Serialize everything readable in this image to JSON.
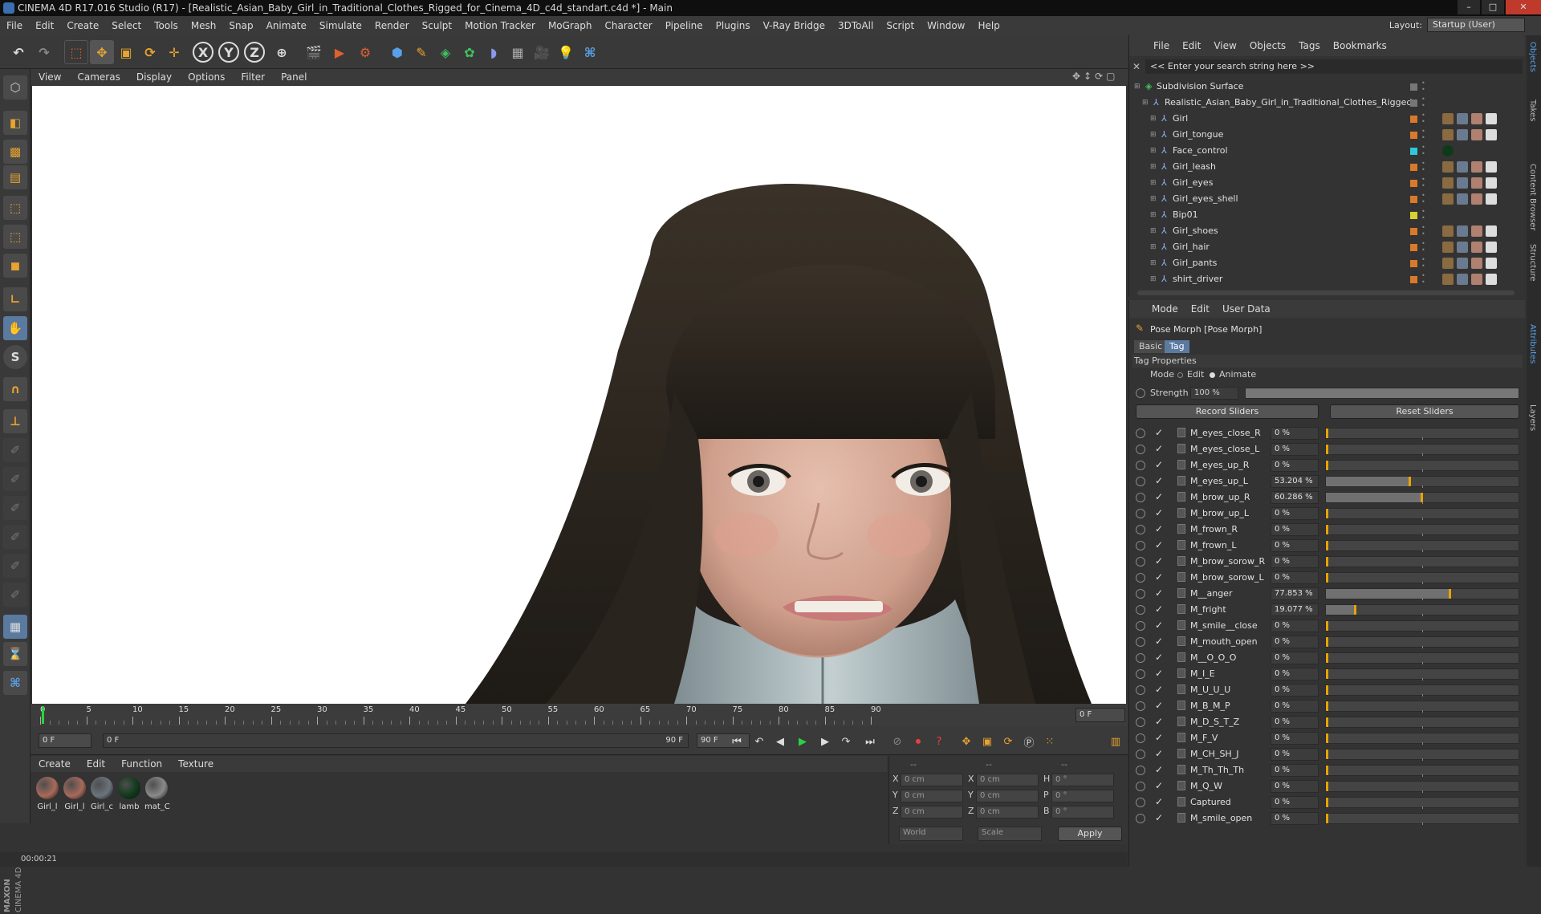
{
  "window": {
    "title": "CINEMA 4D R17.016 Studio (R17) - [Realistic_Asian_Baby_Girl_in_Traditional_Clothes_Rigged_for_Cinema_4D_c4d_standart.c4d *] - Main"
  },
  "menubar": [
    "File",
    "Edit",
    "Create",
    "Select",
    "Tools",
    "Mesh",
    "Snap",
    "Animate",
    "Simulate",
    "Render",
    "Sculpt",
    "Motion Tracker",
    "MoGraph",
    "Character",
    "Pipeline",
    "Plugins",
    "V-Ray Bridge",
    "3DToAll",
    "Script",
    "Window",
    "Help"
  ],
  "layout": {
    "label": "Layout:",
    "value": "Startup (User)"
  },
  "toolbar": {
    "x_axis": "X",
    "y_axis": "Y",
    "z_axis": "Z"
  },
  "viewport_menu": [
    "View",
    "Cameras",
    "Display",
    "Options",
    "Filter",
    "Panel"
  ],
  "timeline": {
    "ticks": [
      "0",
      "5",
      "10",
      "15",
      "20",
      "25",
      "30",
      "35",
      "40",
      "45",
      "50",
      "55",
      "60",
      "65",
      "70",
      "75",
      "80",
      "85",
      "90"
    ],
    "current_frame": "0 F",
    "start_field": "0 F",
    "range_start": "0 F",
    "range_end": "90 F",
    "end_field": "90 F"
  },
  "material_manager": {
    "menu": [
      "Create",
      "Edit",
      "Function",
      "Texture"
    ],
    "materials": [
      {
        "name": "Girl_l",
        "color": "#a86a5a"
      },
      {
        "name": "Girl_l",
        "color": "#a86a5a"
      },
      {
        "name": "Girl_c",
        "color": "#6b747e"
      },
      {
        "name": "lamb",
        "color": "#0f3a1a"
      },
      {
        "name": "mat_C",
        "color": "#8a8a8a"
      }
    ]
  },
  "coordinates": {
    "headers": [
      "--",
      "--",
      "--"
    ],
    "rows": [
      {
        "a": "X",
        "av": "0 cm",
        "b": "X",
        "bv": "0 cm",
        "c": "H",
        "cv": "0 °"
      },
      {
        "a": "Y",
        "av": "0 cm",
        "b": "Y",
        "bv": "0 cm",
        "c": "P",
        "cv": "0 °"
      },
      {
        "a": "Z",
        "av": "0 cm",
        "b": "Z",
        "bv": "0 cm",
        "c": "B",
        "cv": "0 °"
      }
    ],
    "world": "World",
    "scale": "Scale",
    "apply": "Apply"
  },
  "status": {
    "time": "00:00:21"
  },
  "object_manager": {
    "menu": [
      "File",
      "Edit",
      "View",
      "Objects",
      "Tags",
      "Bookmarks"
    ],
    "search_placeholder": "<< Enter your search string here >>",
    "objects": [
      {
        "name": "Subdivision Surface",
        "indent": 0,
        "color": "#777777"
      },
      {
        "name": "Realistic_Asian_Baby_Girl_in_Traditional_Clothes_Rigged",
        "indent": 1,
        "color": "#777777"
      },
      {
        "name": "Girl",
        "indent": 2,
        "color": "#d87a2a"
      },
      {
        "name": "Girl_tongue",
        "indent": 2,
        "color": "#d87a2a"
      },
      {
        "name": "Face_control",
        "indent": 2,
        "color": "#30c8d8"
      },
      {
        "name": "Girl_leash",
        "indent": 2,
        "color": "#d87a2a"
      },
      {
        "name": "Girl_eyes",
        "indent": 2,
        "color": "#d87a2a"
      },
      {
        "name": "Girl_eyes_shell",
        "indent": 2,
        "color": "#d87a2a"
      },
      {
        "name": "Bip01",
        "indent": 2,
        "color": "#d8d030"
      },
      {
        "name": "Girl_shoes",
        "indent": 2,
        "color": "#d87a2a"
      },
      {
        "name": "Girl_hair",
        "indent": 2,
        "color": "#d87a2a"
      },
      {
        "name": "Girl_pants",
        "indent": 2,
        "color": "#d87a2a"
      },
      {
        "name": "shirt_driver",
        "indent": 2,
        "color": "#d87a2a"
      }
    ]
  },
  "attributes": {
    "menu": [
      "Mode",
      "Edit",
      "User Data"
    ],
    "title": "Pose Morph [Pose Morph]",
    "tabs": [
      "Basic",
      "Tag"
    ],
    "section": "Tag Properties",
    "mode_label": "Mode",
    "mode_edit": "Edit",
    "mode_animate": "Animate",
    "strength_label": "Strength",
    "strength_value": "100 %",
    "strength": 1.0,
    "record_sliders": "Record Sliders",
    "reset_sliders": "Reset Sliders",
    "sliders": [
      {
        "name": "M_eyes_close_R",
        "value": "0 %",
        "fraction": 0
      },
      {
        "name": "M_eyes_close_L",
        "value": "0 %",
        "fraction": 0
      },
      {
        "name": "M_eyes_up_R",
        "value": "0 %",
        "fraction": 0
      },
      {
        "name": "M_eyes_up_L",
        "value": "53.204 %",
        "fraction": 0.53204
      },
      {
        "name": "M_brow_up_R",
        "value": "60.286 %",
        "fraction": 0.60286
      },
      {
        "name": "M_brow_up_L",
        "value": "0 %",
        "fraction": 0
      },
      {
        "name": "M_frown_R",
        "value": "0 %",
        "fraction": 0
      },
      {
        "name": "M_frown_L",
        "value": "0 %",
        "fraction": 0
      },
      {
        "name": "M_brow_sorow_R",
        "value": "0 %",
        "fraction": 0
      },
      {
        "name": "M_brow_sorow_L",
        "value": "0 %",
        "fraction": 0
      },
      {
        "name": "M__anger",
        "value": "77.853 %",
        "fraction": 0.77853
      },
      {
        "name": "M_fright",
        "value": "19.077 %",
        "fraction": 0.19077
      },
      {
        "name": "M_smile__close",
        "value": "0 %",
        "fraction": 0
      },
      {
        "name": "M_mouth_open",
        "value": "0 %",
        "fraction": 0
      },
      {
        "name": "M__O_O_O",
        "value": "0 %",
        "fraction": 0
      },
      {
        "name": "M_I_E",
        "value": "0 %",
        "fraction": 0
      },
      {
        "name": "M_U_U_U",
        "value": "0 %",
        "fraction": 0
      },
      {
        "name": "M_B_M_P",
        "value": "0 %",
        "fraction": 0
      },
      {
        "name": "M_D_S_T_Z",
        "value": "0 %",
        "fraction": 0
      },
      {
        "name": "M_F_V",
        "value": "0 %",
        "fraction": 0
      },
      {
        "name": "M_CH_SH_J",
        "value": "0 %",
        "fraction": 0
      },
      {
        "name": "M_Th_Th_Th",
        "value": "0 %",
        "fraction": 0
      },
      {
        "name": "M_Q_W",
        "value": "0 %",
        "fraction": 0
      },
      {
        "name": "Captured",
        "value": "0 %",
        "fraction": 0
      },
      {
        "name": "M_smile_open",
        "value": "0 %",
        "fraction": 0
      }
    ]
  },
  "side_tabs": [
    "Objects",
    "Takes",
    "Content Browser",
    "Structure",
    "Attributes",
    "Layers"
  ]
}
